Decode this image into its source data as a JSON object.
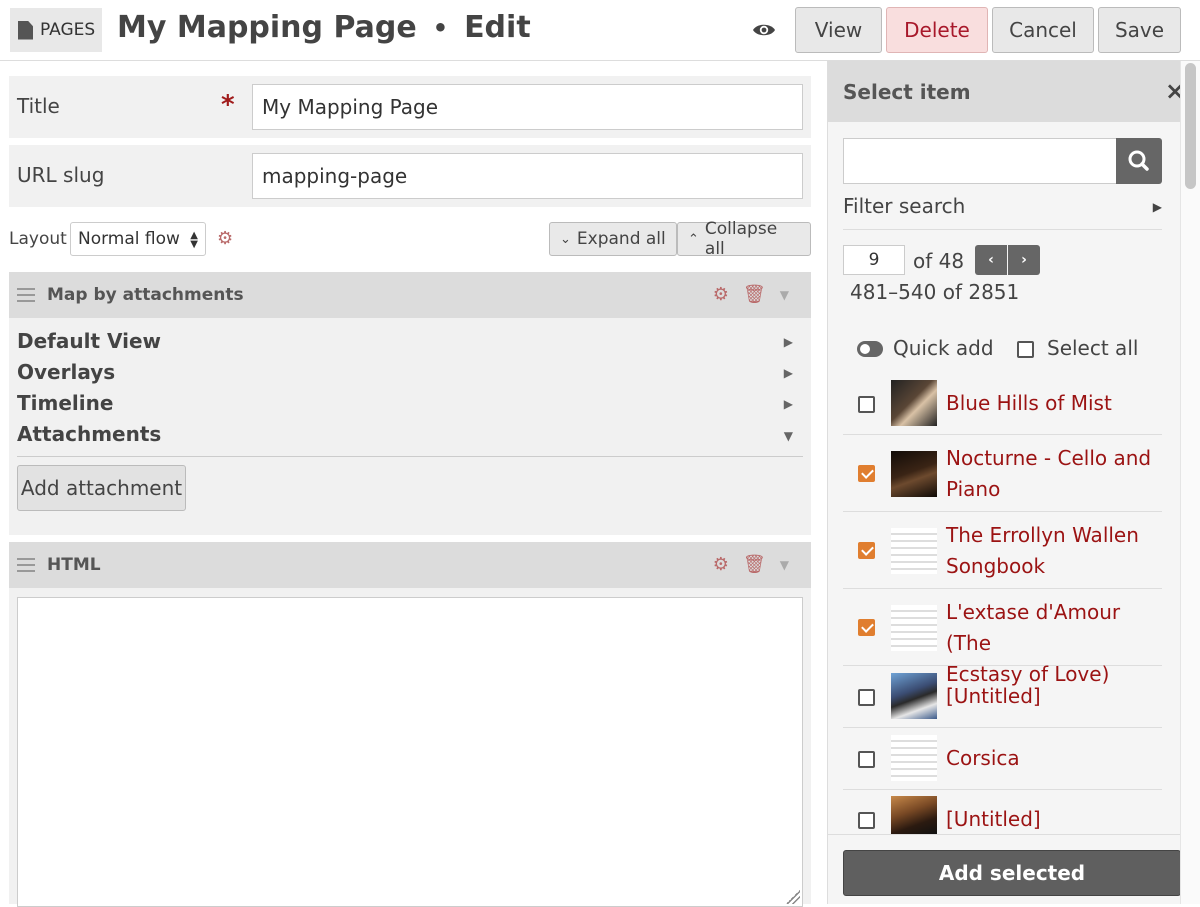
{
  "header": {
    "pages_badge": "PAGES",
    "page_title": "My Mapping Page",
    "separator": "•",
    "mode": "Edit",
    "buttons": {
      "view": "View",
      "delete": "Delete",
      "cancel": "Cancel",
      "save": "Save"
    }
  },
  "form": {
    "title_label": "Title",
    "required_marker": "*",
    "title_value": "My Mapping Page",
    "slug_label": "URL slug",
    "slug_value": "mapping-page",
    "layout_label": "Layout",
    "layout_value": "Normal flow",
    "expand_all": "Expand all",
    "collapse_all": "Collapse all"
  },
  "blocks": {
    "map": {
      "title": "Map by attachments",
      "sections": [
        "Default View",
        "Overlays",
        "Timeline",
        "Attachments"
      ],
      "add_attachment": "Add attachment"
    },
    "html": {
      "title": "HTML"
    }
  },
  "panel": {
    "title": "Select item",
    "close": "×",
    "search_placeholder": "",
    "filter_search": "Filter search",
    "page_value": "9",
    "page_of": "of 48",
    "range": "481–540 of 2851",
    "quick_add": "Quick add",
    "select_all": "Select all",
    "items": [
      {
        "line1": "Blue Hills of Mist",
        "line2": "",
        "checked": false
      },
      {
        "line1": "Nocturne - Cello and",
        "line2": "Piano",
        "checked": true
      },
      {
        "line1": "The Errollyn Wallen",
        "line2": "Songbook",
        "checked": true
      },
      {
        "line1": "L'extase d'Amour (The",
        "line2": "Ecstasy of Love)",
        "checked": true
      },
      {
        "line1": "[Untitled]",
        "line2": "",
        "checked": false
      },
      {
        "line1": "Corsica",
        "line2": "",
        "checked": false
      },
      {
        "line1": "[Untitled]",
        "line2": "",
        "checked": false
      }
    ],
    "add_selected": "Add selected"
  },
  "colors": {
    "accent_red": "#9b1313",
    "check_orange": "#e07e2f",
    "dark_button": "#5f5f5f"
  }
}
